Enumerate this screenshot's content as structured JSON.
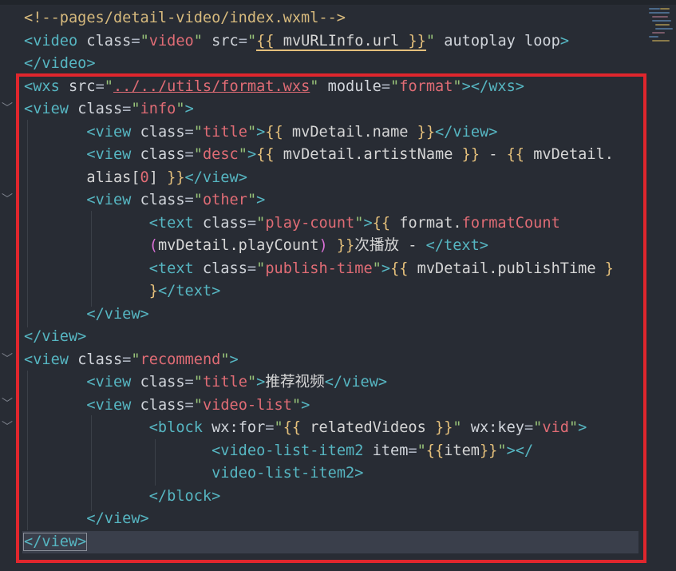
{
  "editor": {
    "language": "wxml",
    "lines": [
      {
        "id": "l1",
        "text": "<!--pages/detail-video/index.wxml-->"
      },
      {
        "id": "l2",
        "text": "<video class=\"video\" src=\"{{ mvURLInfo.url }}\" autoplay loop>"
      },
      {
        "id": "l3",
        "text": "</video>"
      },
      {
        "id": "l4",
        "text": "<wxs src=\"../../utils/format.wxs\" module=\"format\"></wxs>"
      },
      {
        "id": "l5",
        "text": "<view class=\"info\">"
      },
      {
        "id": "l6",
        "text": "<view class=\"title\">{{ mvDetail.name }}</view>"
      },
      {
        "id": "l7",
        "text": "<view class=\"desc\">{{ mvDetail.artistName }} - {{ mvDetail."
      },
      {
        "id": "l8",
        "text": "alias[0] }}</view>"
      },
      {
        "id": "l9",
        "text": "<view class=\"other\">"
      },
      {
        "id": "l10",
        "text": "<text class=\"play-count\">{{ format.formatCount"
      },
      {
        "id": "l11",
        "text": "(mvDetail.playCount) }}次播放 - </text>"
      },
      {
        "id": "l12",
        "text": "<text class=\"publish-time\">{{ mvDetail.publishTime }"
      },
      {
        "id": "l13",
        "text": "}</text>"
      },
      {
        "id": "l14",
        "text": "</view>"
      },
      {
        "id": "l15",
        "text": "</view>"
      },
      {
        "id": "l16",
        "text": "<view class=\"recommend\">"
      },
      {
        "id": "l17",
        "text": "<view class=\"title\">推荐视频</view>"
      },
      {
        "id": "l18",
        "text": "<view class=\"video-list\">"
      },
      {
        "id": "l19",
        "text": "<block wx:for=\"{{ relatedVideos }}\" wx:key=\"vid\">"
      },
      {
        "id": "l20",
        "text": "<video-list-item2 item=\"{{item}}\"></"
      },
      {
        "id": "l21",
        "text": "video-list-item2>"
      },
      {
        "id": "l22",
        "text": "</block>"
      },
      {
        "id": "l23",
        "text": "</view>"
      },
      {
        "id": "l24",
        "text": "</view>"
      }
    ],
    "colors": {
      "background": "#282c34",
      "tag": "#56b6c2",
      "string": "#e06c75",
      "bracket": "#e5c07b",
      "bracket_nested": "#da70d6",
      "annotation_box": "#e0262d",
      "current_line": "#3a3f4b"
    },
    "fold_icon": "chevron-down-icon"
  }
}
